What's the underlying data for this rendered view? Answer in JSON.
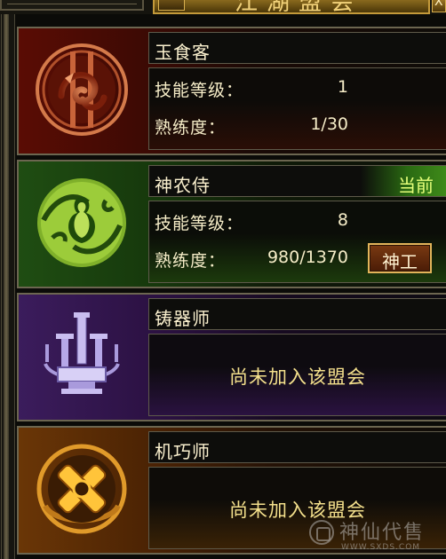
{
  "header": {
    "title": "江湖盟会",
    "close_label": "X"
  },
  "guilds": [
    {
      "name": "玉食客",
      "emblem": "dragon-emblem-icon",
      "status": "",
      "skill_level_label": "技能等级：",
      "skill_level_value": "1",
      "proficiency_label": "熟练度：",
      "proficiency_value": "1/30"
    },
    {
      "name": "神农侍",
      "emblem": "gourd-emblem-icon",
      "status": "当前",
      "skill_level_label": "技能等级：",
      "skill_level_value": "8",
      "proficiency_label": "熟练度：",
      "proficiency_value": "980/1370",
      "rank_button": "神工"
    },
    {
      "name": "铸器师",
      "emblem": "forge-emblem-icon",
      "status": "",
      "message": "尚未加入该盟会"
    },
    {
      "name": "机巧师",
      "emblem": "gear-emblem-icon",
      "status": "",
      "message": "尚未加入该盟会"
    }
  ],
  "watermark": {
    "text": "神仙代售",
    "url": "WWW.SXDS.COM"
  },
  "colors": {
    "text": "#f6edc8",
    "current_status": "#e6ff7a",
    "not_joined": "#f4e08c",
    "frame": "#6c6650"
  }
}
